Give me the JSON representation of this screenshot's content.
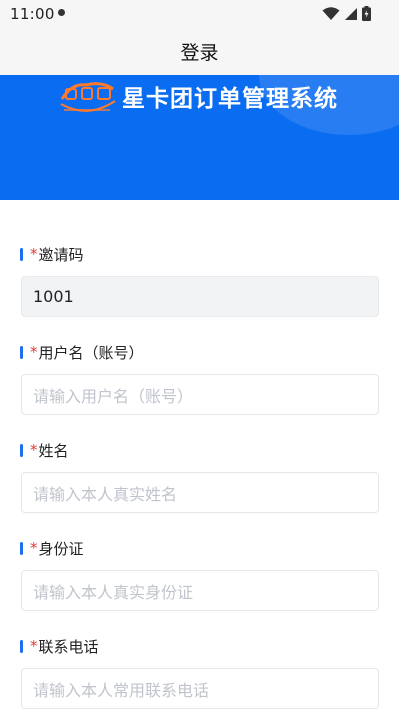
{
  "status": {
    "time": "11:00"
  },
  "header": {
    "title": "登录"
  },
  "banner": {
    "title": "星卡团订单管理系统"
  },
  "form": {
    "required_mark": "*",
    "fields": [
      {
        "label": "邀请码",
        "value": "1001",
        "placeholder": ""
      },
      {
        "label": "用户名（账号）",
        "value": "",
        "placeholder": "请输入用户名（账号）"
      },
      {
        "label": "姓名",
        "value": "",
        "placeholder": "请输入本人真实姓名"
      },
      {
        "label": "身份证",
        "value": "",
        "placeholder": "请输入本人真实身份证"
      },
      {
        "label": "联系电话",
        "value": "",
        "placeholder": "请输入本人常用联系电话"
      }
    ]
  },
  "colors": {
    "brand_blue": "#0a6cf0",
    "accent_bar": "#1e6ff0",
    "required": "#e53935",
    "logo_orange": "#ff7a2d"
  },
  "icons": [
    "notification-dot-icon",
    "wifi-icon",
    "signal-icon",
    "battery-icon",
    "brand-logo"
  ]
}
